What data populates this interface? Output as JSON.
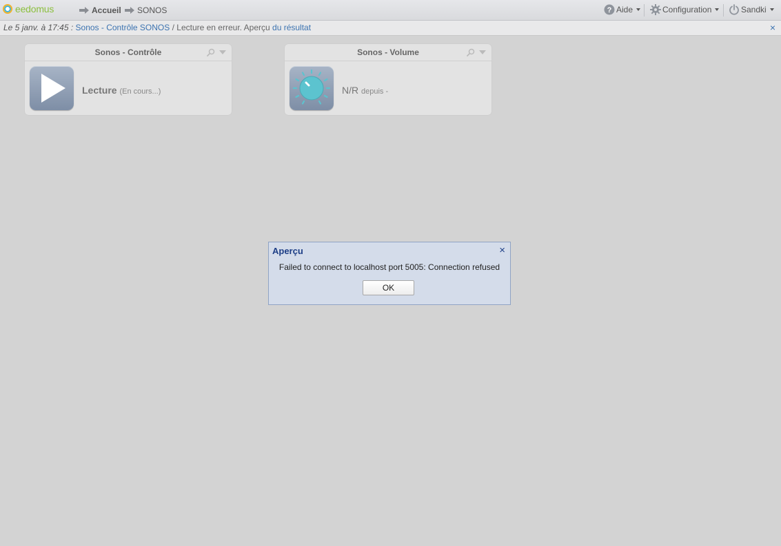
{
  "app": {
    "logo_text": "eedomus"
  },
  "breadcrumb": {
    "home": "Accueil",
    "current": "SONOS"
  },
  "menu": {
    "help": "Aide",
    "config": "Configuration",
    "user": "Sandki"
  },
  "notification": {
    "date": "Le 5 janv. à 17:45 :",
    "device_link": "Sonos - Contrôle SONOS",
    "message": " / Lecture en erreur. Aperçu ",
    "result_link": "du résultat",
    "close": "×"
  },
  "widgets": [
    {
      "title": "Sonos - Contrôle",
      "icon": "play-icon",
      "value": "Lecture",
      "sub": "(En cours...)"
    },
    {
      "title": "Sonos - Volume",
      "icon": "volume-knob-icon",
      "value": "N/R",
      "sub": "depuis -"
    }
  ],
  "dialog": {
    "title": "Aperçu",
    "close": "×",
    "message": "Failed to connect to localhost port 5005: Connection refused",
    "ok_label": "OK"
  },
  "colors": {
    "accent_link": "#3c73b0",
    "dialog_title": "#1d3e86",
    "logo_green": "#8cbf3f",
    "knob_teal": "#5cc3cf"
  }
}
